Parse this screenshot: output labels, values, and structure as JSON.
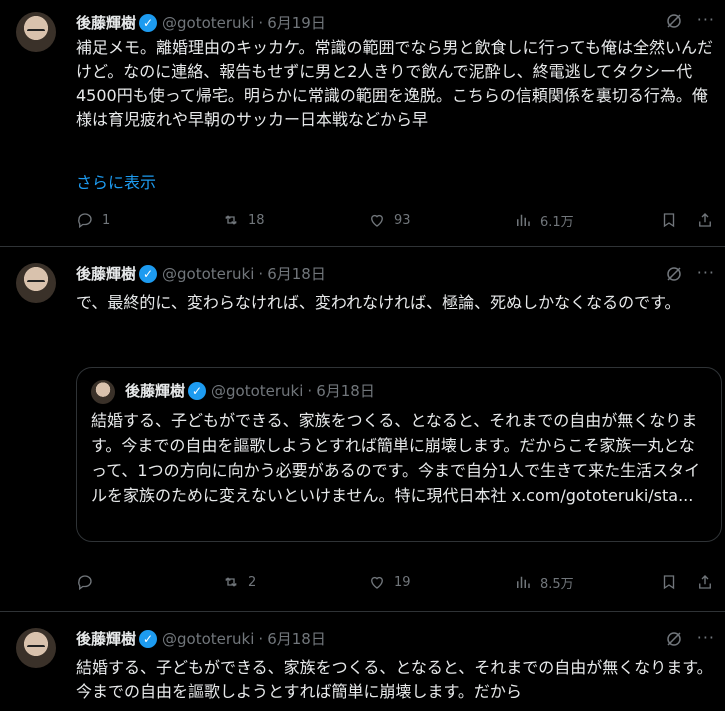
{
  "tweets": [
    {
      "name": "後藤輝樹",
      "handle": "@gototeruki",
      "date": "6月19日",
      "text": "補足メモ。離婚理由のキッカケ。常識の範囲でなら男と飲食しに行っても俺は全然いんだけど。なのに連絡、報告もせずに男と2人きりで飲んで泥酔し、終電逃してタクシー代4500円も使って帰宅。明らかに常識の範囲を逸脱。こちらの信頼関係を裏切る行為。俺様は育児疲れや早朝のサッカー日本戦などから早",
      "show_more": "さらに表示",
      "replies": "1",
      "retweets": "18",
      "likes": "93",
      "views": "6.1万"
    },
    {
      "name": "後藤輝樹",
      "handle": "@gototeruki",
      "date": "6月18日",
      "text": "で、最終的に、変わらなければ、変われなければ、極論、死ぬしかなくなるのです。",
      "quote": {
        "name": "後藤輝樹",
        "handle": "@gototeruki",
        "date": "6月18日",
        "text": "結婚する、子どもができる、家族をつくる、となると、それまでの自由が無くなります。今までの自由を謳歌しようとすれば簡単に崩壊します。だからこそ家族一丸となって、1つの方向に向かう必要があるのです。今まで自分1人で生きて来た生活スタイルを家族のために変えないといけません。特に現代日本社 x.com/gototeruki/sta..."
      },
      "replies": "",
      "retweets": "2",
      "likes": "19",
      "views": "8.5万"
    },
    {
      "name": "後藤輝樹",
      "handle": "@gototeruki",
      "date": "6月18日",
      "text": "結婚する、子どもができる、家族をつくる、となると、それまでの自由が無くなります。今までの自由を謳歌しようとすれば簡単に崩壊します。だから"
    }
  ],
  "separator": "·",
  "verified_mark": "✓",
  "more_glyph": "···",
  "colors": {
    "accent": "#1d9bf0",
    "muted": "#71767b",
    "background": "#000000"
  },
  "icons": [
    "verified-badge-icon",
    "grok-icon",
    "more-icon",
    "reply-icon",
    "retweet-icon",
    "like-icon",
    "views-icon",
    "bookmark-icon",
    "share-icon"
  ]
}
